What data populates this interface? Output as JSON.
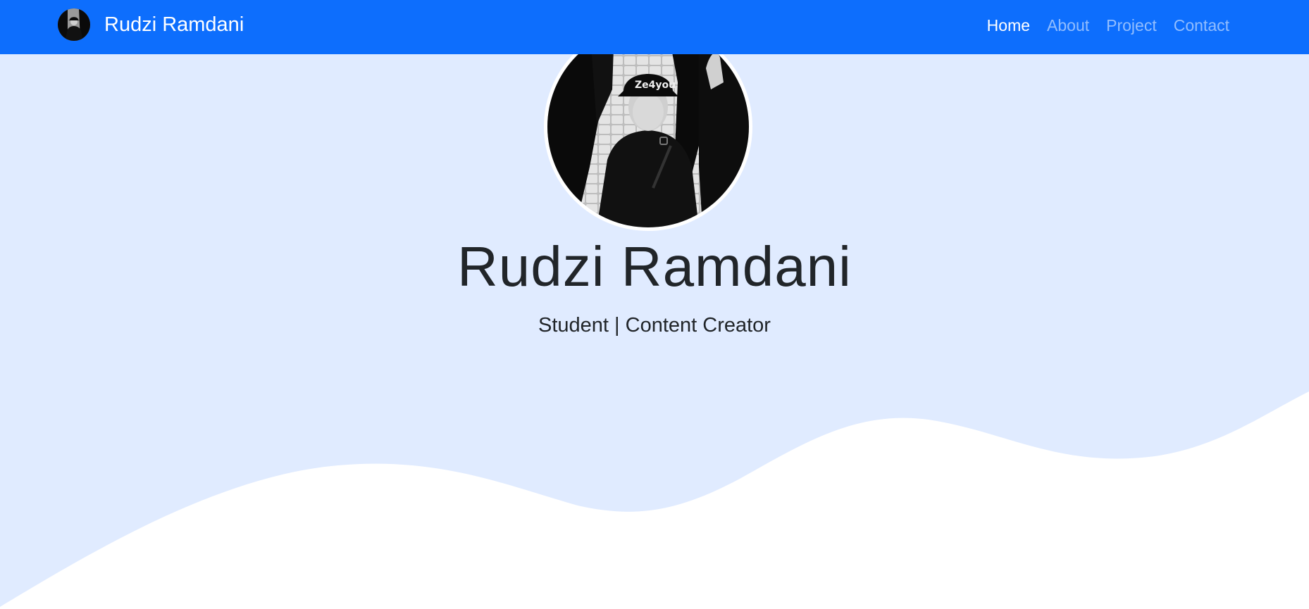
{
  "navbar": {
    "brand_name": "Rudzi Ramdani",
    "links": [
      {
        "label": "Home",
        "active": true
      },
      {
        "label": "About",
        "active": false
      },
      {
        "label": "Project",
        "active": false
      },
      {
        "label": "Contact",
        "active": false
      }
    ]
  },
  "hero": {
    "name": "Rudzi Ramdani",
    "subtitle": "Student | Content Creator",
    "photo_alt": "Profile photo"
  },
  "colors": {
    "navbar_bg": "#0d6efd",
    "hero_bg": "#e0ebff",
    "wave_fill": "#ffffff",
    "text_dark": "#212529"
  }
}
